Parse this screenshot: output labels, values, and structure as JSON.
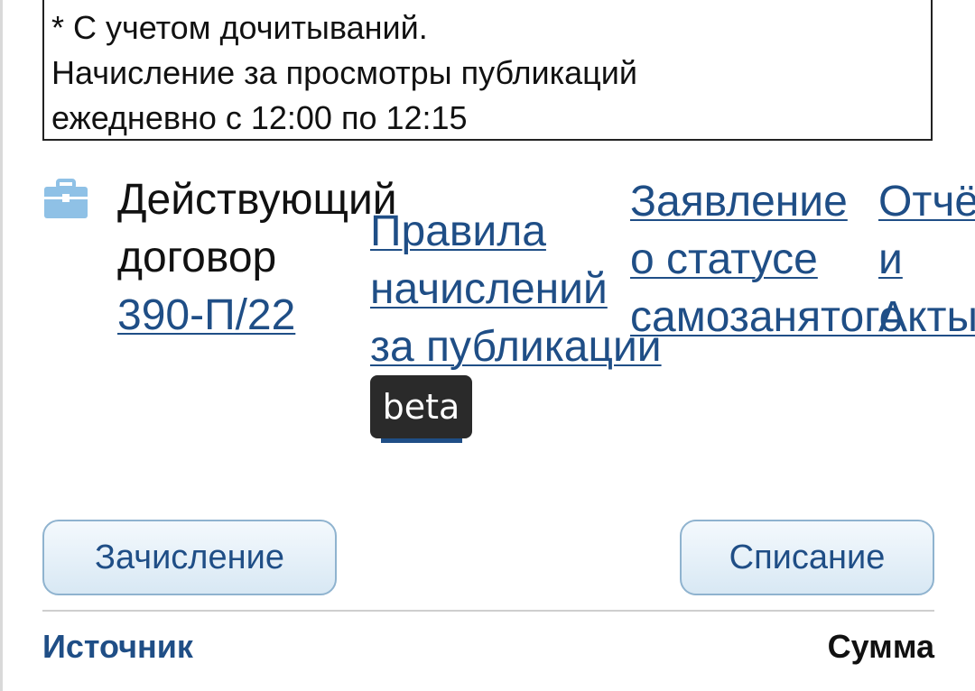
{
  "note": {
    "line1": "* С учетом дочитываний.",
    "line2": "Начисление за просмотры публикаций",
    "line3": "ежедневно с 12:00 по 12:15"
  },
  "contract": {
    "icon": "briefcase-icon",
    "label_line1": "Действующий",
    "label_line2": "договор",
    "number": "390-П/22"
  },
  "links": {
    "rules_line1": "Правила",
    "rules_line2": "начислений",
    "rules_line3": "за публикации",
    "rules_badge": "beta",
    "statement_line1": "Заявление",
    "statement_line2": "о статусе",
    "statement_line3": "самозанятого",
    "reports_line1": "Отчё",
    "reports_line2": "и",
    "reports_line3": "Акты"
  },
  "buttons": {
    "credit": "Зачисление",
    "debit": "Списание"
  },
  "table": {
    "col_source": "Источник",
    "col_sum": "Сумма"
  },
  "colors": {
    "link": "#1f4e86",
    "icon": "#8fc1e6",
    "badge": "#2a2a2a"
  }
}
